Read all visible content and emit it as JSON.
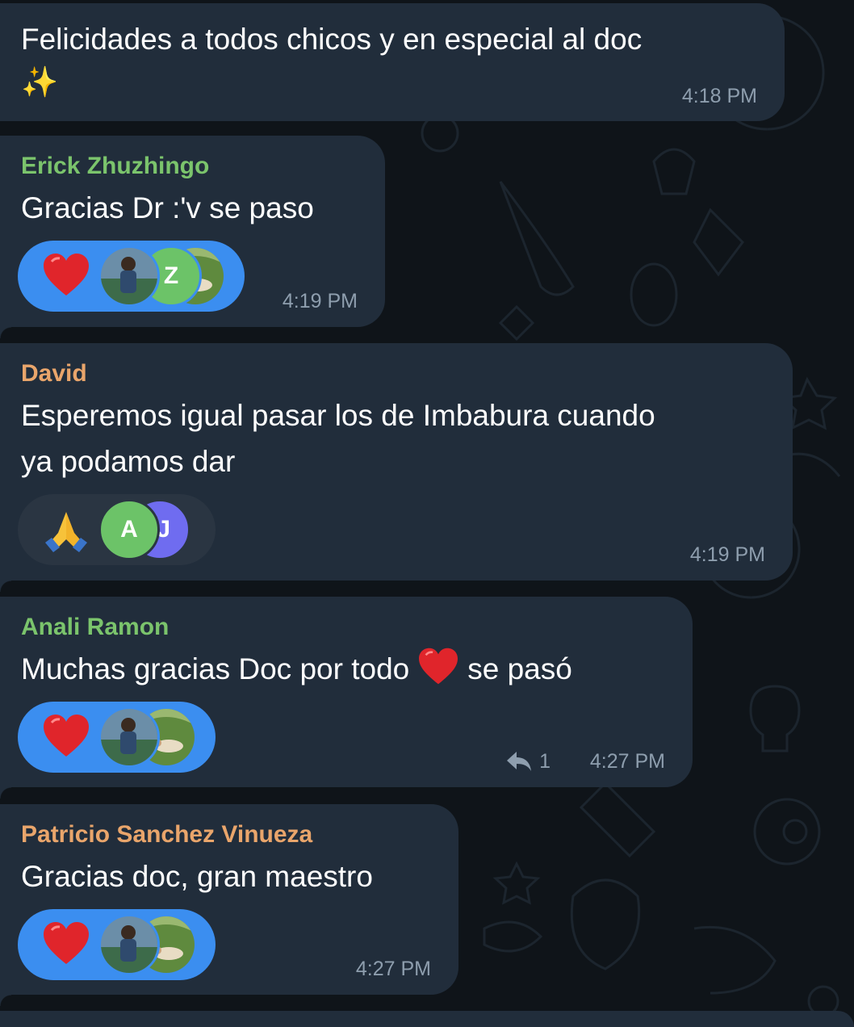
{
  "messages": [
    {
      "text_lines": [
        "Felicidades a todos chicos y en especial al doc",
        "✨"
      ],
      "time": "4:18 PM"
    },
    {
      "sender": "Erick Zhuzhingo",
      "sender_color": "#7bc46c",
      "text_lines": [
        "Gracias Dr :'v se paso"
      ],
      "reaction": {
        "emoji": "red-heart",
        "avatars": [
          "photo-man-lake",
          "Z",
          "photo-hammock"
        ]
      },
      "time": "4:19 PM"
    },
    {
      "sender": "David",
      "sender_color": "#e9a56b",
      "text_lines": [
        "Esperemos igual pasar los de Imbabura cuando",
        "ya podamos dar"
      ],
      "reaction": {
        "emoji": "folded-hands",
        "avatars": [
          "A",
          "J"
        ]
      },
      "time": "4:19 PM"
    },
    {
      "sender": "Anali Ramon",
      "sender_color": "#7bc46c",
      "text_before": "Muchas gracias Doc por todo",
      "text_after": "se pasó",
      "reaction": {
        "emoji": "red-heart",
        "avatars": [
          "photo-man-lake",
          "photo-hammock"
        ]
      },
      "reply_count": "1",
      "time": "4:27 PM"
    },
    {
      "sender": "Patricio Sanchez Vinueza",
      "sender_color": "#e9a56b",
      "text_lines": [
        "Gracias doc, gran maestro"
      ],
      "reaction": {
        "emoji": "red-heart",
        "avatars": [
          "photo-man-lake",
          "photo-hammock"
        ]
      },
      "time": "4:27 PM"
    }
  ],
  "colors": {
    "bubble": "#212d3b",
    "reaction_active": "#3b8ef0",
    "reaction_inactive": "#2a3542",
    "letter_avatar_green": "#6cc368",
    "letter_avatar_purple": "#6f6cf0"
  }
}
